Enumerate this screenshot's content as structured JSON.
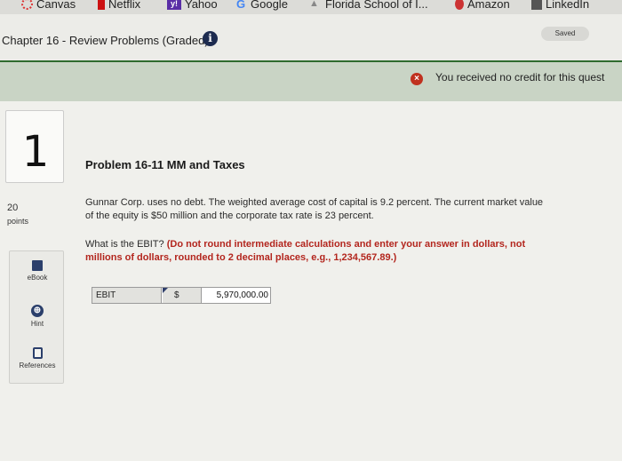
{
  "bookmarks": [
    {
      "label": "Canvas"
    },
    {
      "label": "Netflix"
    },
    {
      "label": "Yahoo"
    },
    {
      "label": "Google"
    },
    {
      "label": "Florida School of I..."
    },
    {
      "label": "Amazon"
    },
    {
      "label": "LinkedIn"
    }
  ],
  "header": {
    "chapter_title": "Chapter 16 - Review Problems (Graded)",
    "info_icon_glyph": "i",
    "saved_label": "Saved"
  },
  "credit_notice": {
    "icon_glyph": "×",
    "message": "You received no credit for this quest"
  },
  "question": {
    "number": "1",
    "points": "20",
    "points_label": "points",
    "title": "Problem 16-11 MM and Taxes",
    "body": "Gunnar Corp. uses no debt. The weighted average cost of capital is 9.2 percent. The current market value of the equity is $50 million and the corporate tax rate is 23 percent.",
    "prompt": "What is the EBIT?",
    "instruction": "(Do not round intermediate calculations and enter your answer in dollars, not millions of dollars, rounded to 2 decimal places, e.g., 1,234,567.89.)"
  },
  "tools": [
    {
      "label": "eBook",
      "icon": "book-icon"
    },
    {
      "label": "Hint",
      "icon": "globe-icon"
    },
    {
      "label": "References",
      "icon": "document-icon"
    }
  ],
  "answer": {
    "label": "EBIT",
    "currency": "$",
    "value": "5,970,000.00"
  },
  "colors": {
    "accent_navy": "#1d2b4f",
    "error_red": "#b3261e",
    "credit_bar": "#c9d4c5"
  }
}
